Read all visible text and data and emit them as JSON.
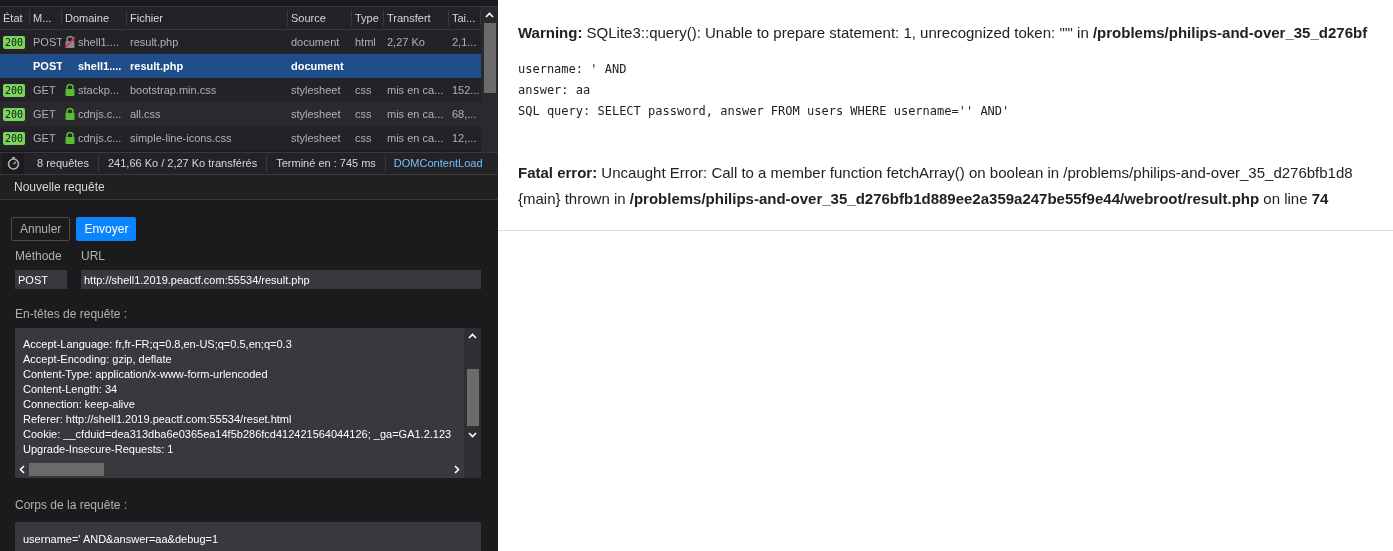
{
  "network": {
    "columns": [
      "État",
      "M...",
      "Domaine",
      "Fichier",
      "Source",
      "Type",
      "Transfert",
      "Tai..."
    ],
    "rows": [
      {
        "status": "200",
        "method": "POST",
        "secure": false,
        "domain": "shell1....",
        "file": "result.php",
        "source": "document",
        "type": "html",
        "transfer": "2,27 Ko",
        "size": "2,1...",
        "selected": false
      },
      {
        "method": "POST",
        "domain": "shell1....",
        "file": "result.php",
        "source": "document",
        "selected": true
      },
      {
        "status": "200",
        "method": "GET",
        "secure": true,
        "domain": "stackp...",
        "file": "bootstrap.min.css",
        "source": "stylesheet",
        "type": "css",
        "transfer": "mis en ca...",
        "size": "152...",
        "selected": false
      },
      {
        "status": "200",
        "method": "GET",
        "secure": true,
        "domain": "cdnjs.c...",
        "file": "all.css",
        "source": "stylesheet",
        "type": "css",
        "transfer": "mis en ca...",
        "size": "68,...",
        "selected": false
      },
      {
        "status": "200",
        "method": "GET",
        "secure": true,
        "domain": "cdnjs.c...",
        "file": "simple-line-icons.css",
        "source": "stylesheet",
        "type": "css",
        "transfer": "mis en ca...",
        "size": "12,...",
        "selected": false
      }
    ],
    "summary": [
      "8 requêtes",
      "241,66 Ko / 2,27 Ko transférés",
      "Terminé en : 745 ms"
    ],
    "summary_link": "DOMContentLoad"
  },
  "request_panel": {
    "title": "Nouvelle requête",
    "cancel": "Annuler",
    "send": "Envoyer",
    "method_label": "Méthode",
    "url_label": "URL",
    "method": "POST",
    "url": "http://shell1.2019.peactf.com:55534/result.php",
    "headers_label": "En-têtes de requête :",
    "headers": [
      "Accept-Language: fr,fr-FR;q=0.8,en-US;q=0.5,en;q=0.3",
      "Accept-Encoding: gzip, deflate",
      "Content-Type: application/x-www-form-urlencoded",
      "Content-Length: 34",
      "Connection: keep-alive",
      "Referer: http://shell1.2019.peactf.com:55534/reset.html",
      "Cookie: __cfduid=dea313dba6e0365ea14f5b286fcd412421564044126; _ga=GA1.2.123",
      "Upgrade-Insecure-Requests: 1"
    ],
    "body_label": "Corps de la requête :",
    "body": "username=' AND&answer=aa&debug=1"
  },
  "page": {
    "warning": "**Warning:** SQLite3::query(): Unable to prepare statement: 1, unrecognized token: \"'\" in **/problems/philips-and-over_35_d276bf**",
    "debug": [
      "username: ' AND",
      "answer: aa",
      "SQL query: SELECT password, answer FROM users WHERE username='' AND'"
    ],
    "fatal": [
      "**Fatal error:** Uncaught Error: Call to a member function fetchArray() on boolean in /problems/philips-and-over_35_d276bfb1d8",
      "{main} thrown in **/problems/philips-and-over_35_d276bfb1d889ee2a359a247be55f9e44/webroot/result.php** on line **74**"
    ]
  }
}
